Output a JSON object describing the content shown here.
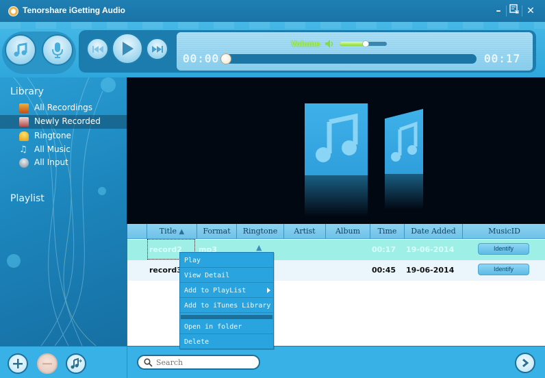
{
  "window": {
    "title": "Tenorshare iGetting Audio",
    "controls": {
      "minimize": "–",
      "mini_mode": "⇱",
      "close": "✕"
    }
  },
  "toolbar": {
    "mode_buttons": [
      {
        "name": "music-mode",
        "icon": "music-note-icon"
      },
      {
        "name": "record-mode",
        "icon": "microphone-icon"
      }
    ],
    "transport": [
      {
        "name": "previous",
        "icon": "skip-back-icon"
      },
      {
        "name": "play",
        "icon": "play-icon"
      },
      {
        "name": "next",
        "icon": "skip-forward-icon"
      }
    ],
    "elapsed_time": "00:00",
    "total_time": "00:17",
    "progress": 0,
    "volume_label": "Volume",
    "volume": 0.55,
    "colors": {
      "volume_label": "#a6f04c",
      "progress_track": "#1c76a5"
    }
  },
  "sidebar": {
    "library_heading": "Library",
    "items": [
      {
        "label": "All Recordings",
        "icon": "recordings-icon",
        "selected": false
      },
      {
        "label": "Newly Recorded",
        "icon": "new-recording-icon",
        "selected": true
      },
      {
        "label": "Ringtone",
        "icon": "bell-icon",
        "selected": false
      },
      {
        "label": "All Music",
        "icon": "music-icon",
        "selected": false
      },
      {
        "label": "All Input",
        "icon": "microphone-icon",
        "selected": false
      }
    ],
    "playlist_heading": "Playlist"
  },
  "table": {
    "columns": [
      "Title",
      "Format",
      "Ringtone",
      "Artist",
      "Album",
      "Time",
      "Date Added",
      "MusicID"
    ],
    "sort_column": "Title",
    "sort_direction": "ascending",
    "rows": [
      {
        "title": "record2",
        "format": "mp3",
        "ringtone": "bell",
        "artist": "",
        "album": "",
        "time": "00:17",
        "date_added": "19-06-2014",
        "music_id": "Identify",
        "selected": true
      },
      {
        "title": "record3",
        "format": "",
        "ringtone": "",
        "artist": "",
        "album": "",
        "time": "00:45",
        "date_added": "19-06-2014",
        "music_id": "Identify",
        "selected": false
      }
    ]
  },
  "context_menu": {
    "items": [
      {
        "label": "Play"
      },
      {
        "label": "View Detail"
      },
      {
        "label": "Add to PlayList",
        "submenu": true
      },
      {
        "label": "Add to iTunes Library"
      },
      {
        "label": "Open in folder"
      },
      {
        "label": "Delete"
      }
    ]
  },
  "bottom_bar": {
    "buttons": [
      {
        "name": "add",
        "icon": "plus-icon",
        "enabled": true
      },
      {
        "name": "remove",
        "icon": "minus-icon",
        "enabled": false
      },
      {
        "name": "export",
        "icon": "music-export-icon",
        "enabled": true
      }
    ],
    "search_placeholder": "Search",
    "next_icon": "chevron-right-icon"
  }
}
